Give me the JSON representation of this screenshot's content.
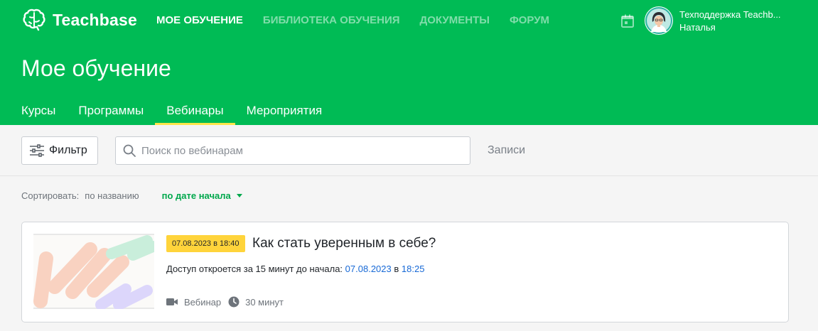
{
  "header": {
    "brand": "Teachbase",
    "nav": [
      "МОЕ ОБУЧЕНИЕ",
      "БИБЛИОТЕКА ОБУЧЕНИЯ",
      "ДОКУМЕНТЫ",
      "ФОРУМ"
    ],
    "user": {
      "name": "Техподдержка Teachb...",
      "subname": "Наталья"
    },
    "calendar_icon": "calendar-icon",
    "title": "Мое обучение",
    "tabs": [
      "Курсы",
      "Программы",
      "Вебинары",
      "Мероприятия"
    ],
    "active_tab": "Вебинары",
    "colors": {
      "brand": "#00bb55",
      "tab_underline": "#ffe54a"
    }
  },
  "toolbar": {
    "filter_label": "Фильтр",
    "search_placeholder": "Поиск по вебинарам",
    "records_label": "Записи"
  },
  "sort": {
    "label": "Сортировать:",
    "by_name": "по названию",
    "by_date": "по дате начала"
  },
  "webinar": {
    "date_badge": "07.08.2023 в 18:40",
    "title": "Как стать уверенным в себе?",
    "access_text": "Доступ откроется за 15 минут до начала:",
    "access_date": "07.08.2023",
    "access_in": "в",
    "access_time": "18:25",
    "type": "Вебинар",
    "duration": "30 минут",
    "colors": {
      "badge": "#ffd43b",
      "link": "#1769d6"
    }
  }
}
